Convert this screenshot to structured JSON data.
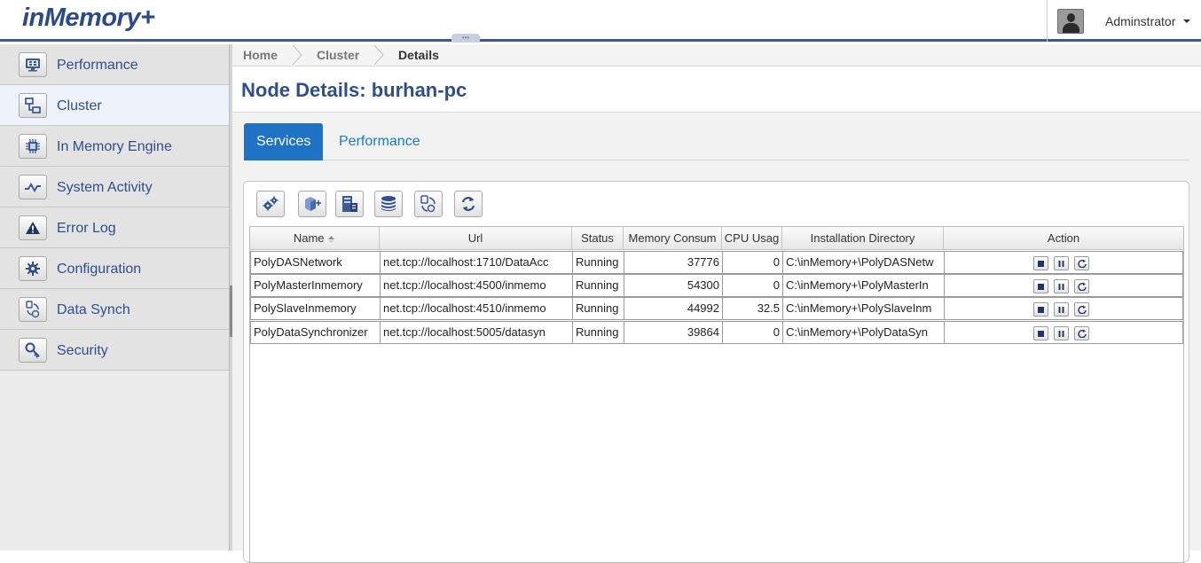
{
  "app": {
    "logo_text": "inMemory+",
    "brand_color": "#2c4a88"
  },
  "header": {
    "user_name": "Adminstrator",
    "collapse_glyph": "•••"
  },
  "sidebar": {
    "items": [
      {
        "label": "Performance",
        "icon": "monitor-icon"
      },
      {
        "label": "Cluster",
        "icon": "cluster-icon",
        "active": true
      },
      {
        "label": "In Memory Engine",
        "icon": "chip-icon"
      },
      {
        "label": "System Activity",
        "icon": "activity-icon"
      },
      {
        "label": "Error Log",
        "icon": "warning-icon"
      },
      {
        "label": "Configuration",
        "icon": "gear-icon"
      },
      {
        "label": "Data Synch",
        "icon": "sync-icon"
      },
      {
        "label": "Security",
        "icon": "key-icon"
      }
    ]
  },
  "breadcrumb": {
    "items": [
      "Home",
      "Cluster",
      "Details"
    ]
  },
  "page": {
    "title": "Node Details: burhan-pc"
  },
  "tabs": [
    {
      "label": "Services",
      "active": true
    },
    {
      "label": "Performance",
      "active": false
    }
  ],
  "toolbar": {
    "buttons": [
      "settings-icon",
      "add-service-icon",
      "server-icon",
      "database-icon",
      "data-sync-icon",
      "refresh-icon"
    ]
  },
  "grid": {
    "columns": [
      "Name",
      "Url",
      "Status",
      "Memory Consum",
      "CPU Usag",
      "Installation Directory",
      "Action"
    ],
    "sort_column": "Name",
    "rows": [
      {
        "name": "PolyDASNetwork",
        "url": "net.tcp://localhost:1710/DataAcc",
        "status": "Running",
        "memory": "37776",
        "cpu": "0",
        "dir": "C:\\inMemory+\\PolyDASNetw"
      },
      {
        "name": "PolyMasterInmemory",
        "url": "net.tcp://localhost:4500/inmemo",
        "status": "Running",
        "memory": "54300",
        "cpu": "0",
        "dir": "C:\\inMemory+\\PolyMasterIn"
      },
      {
        "name": "PolySlaveInmemory",
        "url": "net.tcp://localhost:4510/inmemo",
        "status": "Running",
        "memory": "44992",
        "cpu": "32.5",
        "dir": "C:\\inMemory+\\PolySlaveInm"
      },
      {
        "name": "PolyDataSynchronizer",
        "url": "net.tcp://localhost:5005/datasyn",
        "status": "Running",
        "memory": "39864",
        "cpu": "0",
        "dir": "C:\\inMemory+\\PolyDataSyn"
      }
    ],
    "row_actions": [
      "stop-icon",
      "pause-icon",
      "restart-icon"
    ]
  }
}
